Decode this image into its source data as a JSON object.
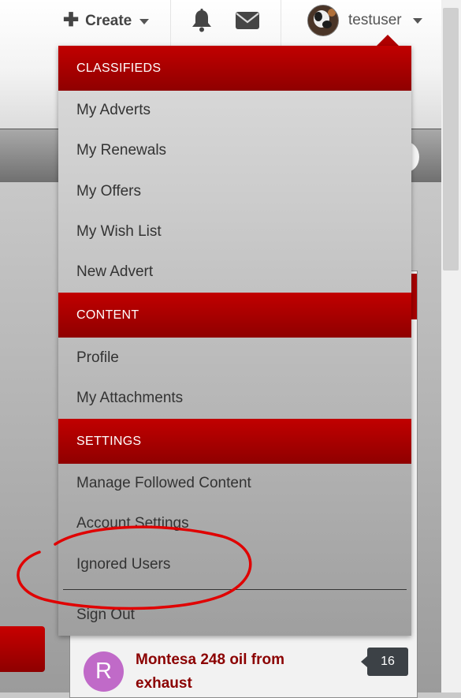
{
  "header": {
    "create_label": "Create",
    "username": "testuser"
  },
  "menu": {
    "classifieds_header": "CLASSIFIEDS",
    "classifieds_items": [
      "My Adverts",
      "My Renewals",
      "My Offers",
      "My Wish List",
      "New Advert"
    ],
    "content_header": "CONTENT",
    "content_items": [
      "Profile",
      "My Attachments"
    ],
    "settings_header": "SETTINGS",
    "settings_items": [
      "Manage Followed Content",
      "Account Settings",
      "Ignored Users"
    ],
    "sign_out": "Sign Out"
  },
  "topic": {
    "avatar_letter": "R",
    "title": "Montesa 248 oil from exhaust",
    "count": "16"
  },
  "colors": {
    "header_red": "#b00000",
    "annotation_red": "#e00000",
    "topic_title_red": "#8b0000",
    "avatar_purple": "#c06ac8"
  },
  "icons": [
    "plus-icon",
    "caret-down-icon",
    "bell-icon",
    "envelope-icon",
    "user-avatar"
  ]
}
